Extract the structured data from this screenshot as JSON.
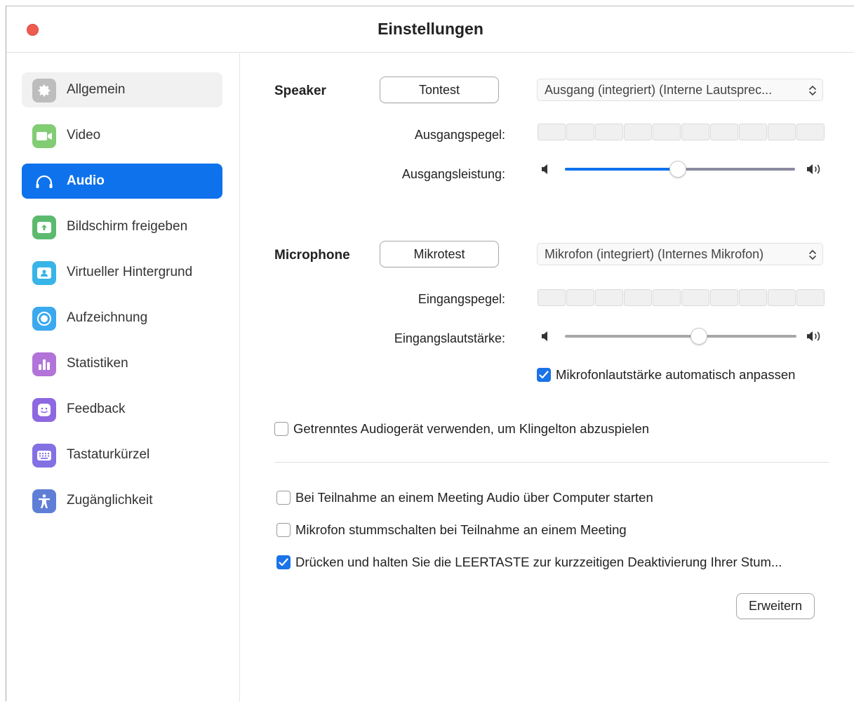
{
  "window": {
    "title": "Einstellungen"
  },
  "colors": {
    "accent": "#0e72ed",
    "close": "#ef5b50"
  },
  "sidebar": {
    "items": [
      {
        "label": "Allgemein",
        "icon": "gear-icon",
        "icon_color": "#bdbdbd",
        "state": "hover"
      },
      {
        "label": "Video",
        "icon": "video-camera-icon",
        "icon_color": "#82cc74",
        "state": ""
      },
      {
        "label": "Audio",
        "icon": "headphones-icon",
        "icon_color": "#0e72ed",
        "state": "active"
      },
      {
        "label": "Bildschirm freigeben",
        "icon": "share-screen-icon",
        "icon_color": "#5cba6e",
        "state": ""
      },
      {
        "label": "Virtueller Hintergrund",
        "icon": "virtual-background-icon",
        "icon_color": "#38b4e8",
        "state": ""
      },
      {
        "label": "Aufzeichnung",
        "icon": "record-icon",
        "icon_color": "#3aa9ef",
        "state": ""
      },
      {
        "label": "Statistiken",
        "icon": "statistics-icon",
        "icon_color": "#b274d8",
        "state": ""
      },
      {
        "label": "Feedback",
        "icon": "feedback-smiley-icon",
        "icon_color": "#8d68e0",
        "state": ""
      },
      {
        "label": "Tastaturkürzel",
        "icon": "keyboard-icon",
        "icon_color": "#8371e4",
        "state": ""
      },
      {
        "label": "Zugänglichkeit",
        "icon": "accessibility-icon",
        "icon_color": "#5f7fd6",
        "state": ""
      }
    ]
  },
  "speaker": {
    "label": "Speaker",
    "test_button": "Tontest",
    "device": "Ausgang (integriert) (Interne Lautsprec...",
    "level_label": "Ausgangspegel:",
    "volume_label": "Ausgangsleistung:",
    "volume": 0.49
  },
  "microphone": {
    "label": "Microphone",
    "test_button": "Mikrotest",
    "device": "Mikrofon (integriert) (Internes Mikrofon)",
    "level_label": "Eingangspegel:",
    "volume_label": "Eingangslautstärke:",
    "volume": 0.58,
    "auto_adjust": {
      "label": "Mikrofonlautstärke automatisch anpassen",
      "checked": true
    }
  },
  "separate_ringtone": {
    "label": "Getrenntes Audiogerät verwenden, um Klingelton abzuspielen",
    "checked": false
  },
  "options": [
    {
      "label": "Bei Teilnahme an einem Meeting Audio über Computer starten",
      "checked": false
    },
    {
      "label": "Mikrofon stummschalten bei Teilnahme an einem Meeting",
      "checked": false
    },
    {
      "label": "Drücken und halten Sie die LEERTASTE zur kurzzeitigen Deaktivierung Ihrer Stum...",
      "checked": true
    }
  ],
  "advanced_button": "Erweitern"
}
